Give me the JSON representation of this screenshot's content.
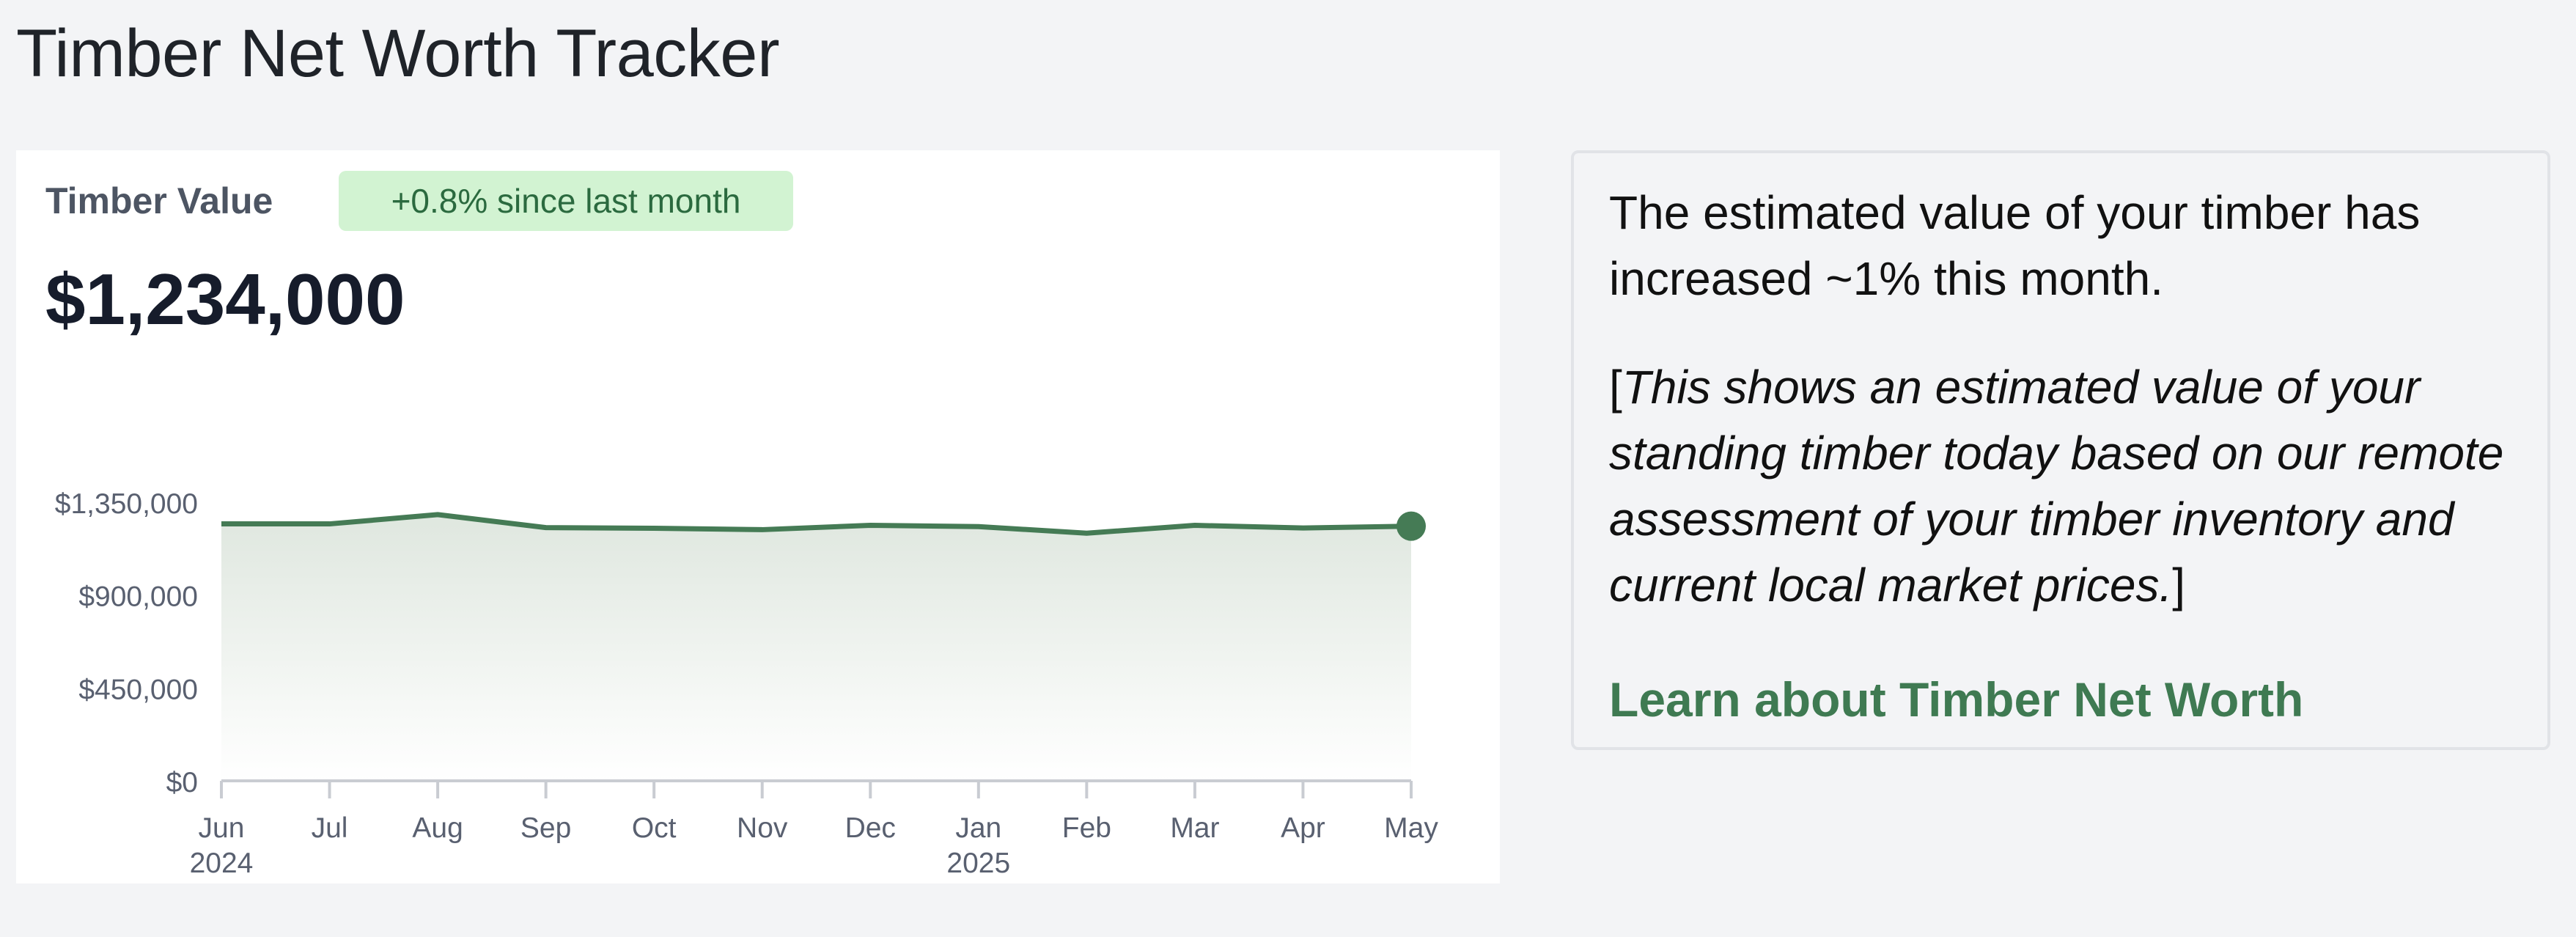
{
  "page": {
    "title": "Timber Net Worth Tracker"
  },
  "chart_card": {
    "label": "Timber Value",
    "badge": "+0.8% since last month",
    "value": "$1,234,000"
  },
  "chart_data": {
    "type": "area",
    "categories": [
      "Jun",
      "Jul",
      "Aug",
      "Sep",
      "Oct",
      "Nov",
      "Dec",
      "Jan",
      "Feb",
      "Mar",
      "Apr",
      "May"
    ],
    "year_labels": [
      "2024",
      "",
      "",
      "",
      "",
      "",
      "",
      "2025",
      "",
      "",
      "",
      ""
    ],
    "series": [
      {
        "values": [
          1245000,
          1245000,
          1290000,
          1227000,
          1224000,
          1217000,
          1238000,
          1232000,
          1200000,
          1238000,
          1225000,
          1234000
        ]
      }
    ],
    "y_ticks": [
      "$0",
      "$450,000",
      "$900,000",
      "$1,350,000"
    ],
    "ylim": [
      0,
      1350000
    ],
    "grid": false,
    "colors": {
      "line": "#457b55",
      "fill_top": "#dfe7df",
      "fill_bottom": "#ffffff",
      "axis": "#c9ccd2",
      "tick_text": "#596070"
    }
  },
  "info": {
    "summary": "The estimated value of your timber has increased ~1% this month.",
    "note_open": "[",
    "note_italic": "This shows an estimated value of your standing timber today based on our remote assessment of your timber inventory and current local market prices.",
    "note_close": "]",
    "link_label": "Learn about Timber Net Worth"
  }
}
